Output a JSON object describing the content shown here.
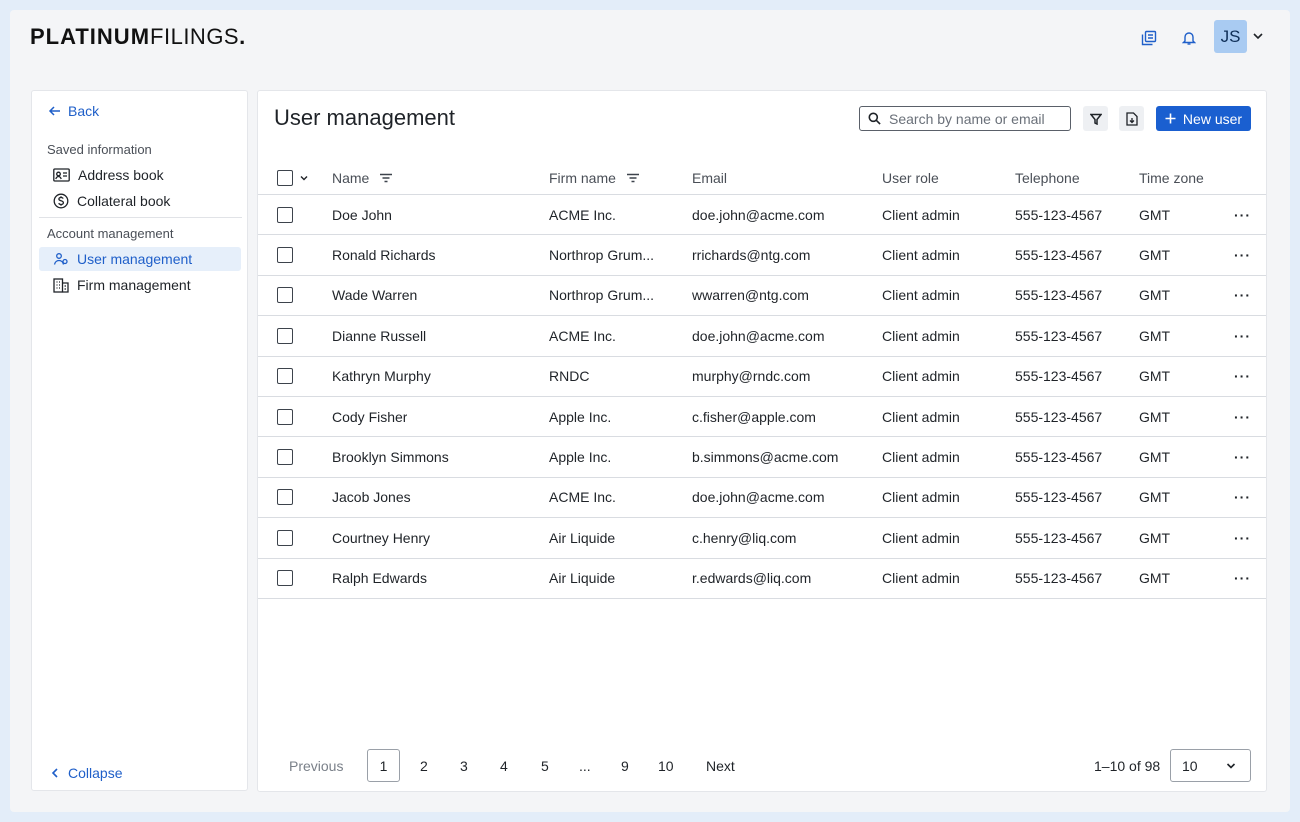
{
  "brand": {
    "bold": "PLATINUM",
    "light": "FILINGS",
    "dot": "."
  },
  "header": {
    "avatar_initials": "JS",
    "icons": [
      "library-icon",
      "bell-icon",
      "chevron-down-icon"
    ]
  },
  "sidebar": {
    "back_label": "Back",
    "saved_section": "Saved information",
    "saved_items": [
      {
        "label": "Address book",
        "icon": "address-card-icon"
      },
      {
        "label": "Collateral book",
        "icon": "dollar-circle-icon"
      }
    ],
    "account_section": "Account management",
    "account_items": [
      {
        "label": "User management",
        "icon": "users-icon",
        "active": true
      },
      {
        "label": "Firm management",
        "icon": "building-icon",
        "active": false
      }
    ],
    "collapse_label": "Collapse"
  },
  "main": {
    "title": "User management",
    "search_placeholder": "Search by name or email",
    "new_user_label": "New user",
    "columns": [
      "Name",
      "Firm name",
      "Email",
      "User role",
      "Telephone",
      "Time zone"
    ],
    "rows": [
      {
        "name": "Doe John",
        "firm": "ACME Inc.",
        "email": "doe.john@acme.com",
        "role": "Client admin",
        "phone": "555-123-4567",
        "tz": "GMT"
      },
      {
        "name": "Ronald Richards",
        "firm": "Northrop Grum...",
        "email": "rrichards@ntg.com",
        "role": "Client admin",
        "phone": "555-123-4567",
        "tz": "GMT"
      },
      {
        "name": "Wade Warren",
        "firm": "Northrop Grum...",
        "email": "wwarren@ntg.com",
        "role": "Client admin",
        "phone": "555-123-4567",
        "tz": "GMT"
      },
      {
        "name": "Dianne Russell",
        "firm": "ACME Inc.",
        "email": "doe.john@acme.com",
        "role": "Client admin",
        "phone": "555-123-4567",
        "tz": "GMT"
      },
      {
        "name": "Kathryn Murphy",
        "firm": "RNDC",
        "email": "murphy@rndc.com",
        "role": "Client admin",
        "phone": "555-123-4567",
        "tz": "GMT"
      },
      {
        "name": "Cody Fisher",
        "firm": "Apple Inc.",
        "email": "c.fisher@apple.com",
        "role": "Client admin",
        "phone": "555-123-4567",
        "tz": "GMT"
      },
      {
        "name": "Brooklyn Simmons",
        "firm": "Apple Inc.",
        "email": "b.simmons@acme.com",
        "role": "Client admin",
        "phone": "555-123-4567",
        "tz": "GMT"
      },
      {
        "name": "Jacob Jones",
        "firm": "ACME Inc.",
        "email": "doe.john@acme.com",
        "role": "Client admin",
        "phone": "555-123-4567",
        "tz": "GMT"
      },
      {
        "name": "Courtney Henry",
        "firm": "Air Liquide",
        "email": "c.henry@liq.com",
        "role": "Client admin",
        "phone": "555-123-4567",
        "tz": "GMT"
      },
      {
        "name": "Ralph Edwards",
        "firm": "Air Liquide",
        "email": "r.edwards@liq.com",
        "role": "Client admin",
        "phone": "555-123-4567",
        "tz": "GMT"
      }
    ],
    "row_action": "···"
  },
  "pagination": {
    "previous": "Previous",
    "pages": [
      "1",
      "2",
      "3",
      "4",
      "5",
      "...",
      "9",
      "10"
    ],
    "current": "1",
    "next": "Next",
    "range": "1–10 of 98",
    "page_size": "10"
  },
  "colors": {
    "accent": "#1a5fd0",
    "active_bg": "#e6effa",
    "avatar_bg": "#a9cbf2",
    "page_bg": "#e3edf9"
  }
}
